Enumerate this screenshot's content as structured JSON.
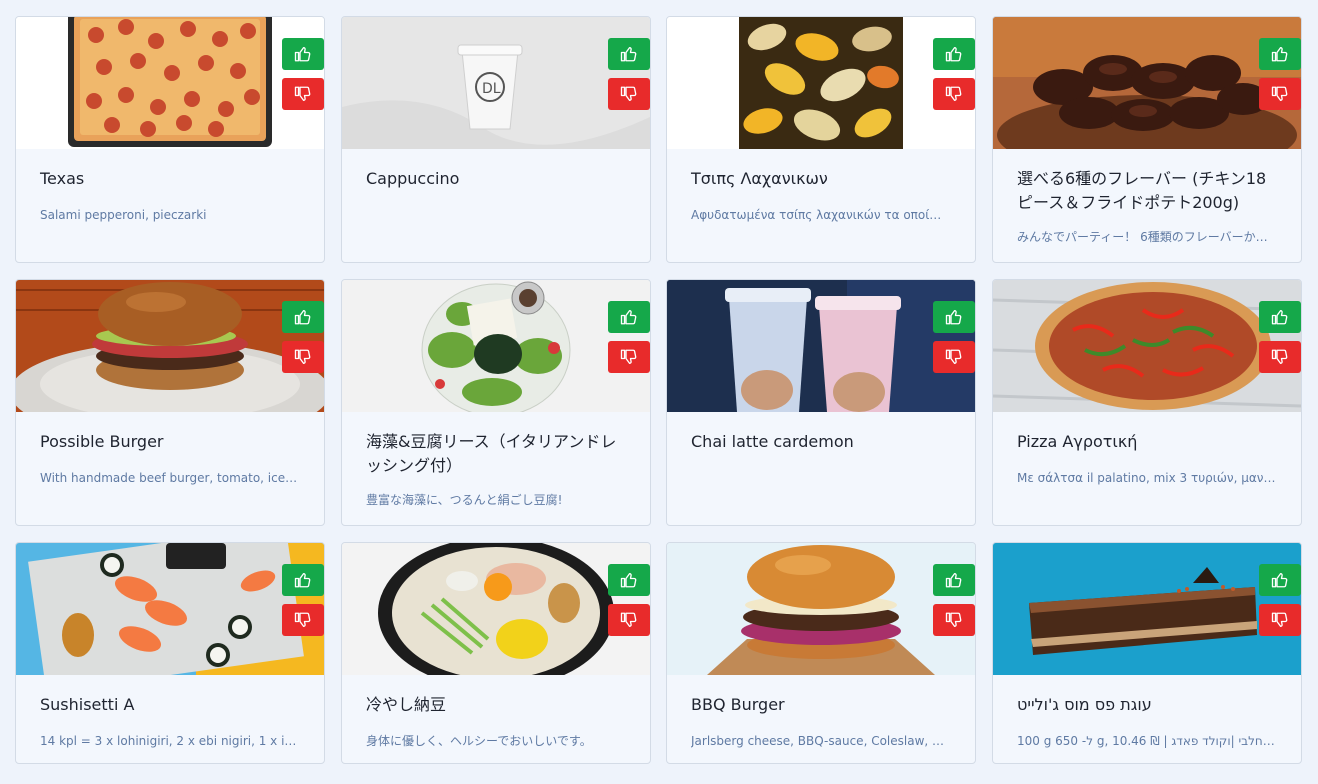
{
  "colors": {
    "like": "#15a84a",
    "dislike": "#e82b2b",
    "title": "#1f2430",
    "description": "#5f7aa3",
    "card_background": "#f3f7fd",
    "page_background": "#eef3fb"
  },
  "icons": {
    "like": "thumbs-up-icon",
    "dislike": "thumbs-down-icon"
  },
  "cards": [
    {
      "title": "Texas",
      "description": "Salami pepperoni, pieczarki",
      "image": "pepperoni-pizza"
    },
    {
      "title": "Cappuccino",
      "description": "",
      "image": "coffee-cup"
    },
    {
      "title": "Τσιπς Λαχανικων",
      "description": "Αφυδατωμένα τσίπς λαχανικών  τα οποί…",
      "image": "vegetable-chips"
    },
    {
      "title": "選べる6種のフレーバー (チキン18ピース＆フライドポテト200g)",
      "description": "みんなでパーティー！ 6種類のフレーバーか…",
      "image": "chicken-wings"
    },
    {
      "title": "Possible Burger",
      "description": "With handmade beef burger, tomato, ice…",
      "image": "burger-plate"
    },
    {
      "title": "海藻&豆腐リース（イタリアンドレッシング付）",
      "description": "豊富な海藻に、つるんと絹ごし豆腐!",
      "image": "seaweed-salad"
    },
    {
      "title": "Chai latte cardemon",
      "description": "",
      "image": "two-cups"
    },
    {
      "title": "Pizza Αγροτική",
      "description": "Με σάλτσα il palatino, mix 3 τυριών, μαν…",
      "image": "peppers-pizza"
    },
    {
      "title": "Sushisetti A",
      "description": "14 kpl = 3 x lohinigiri, 2 x ebi nigiri, 1 x i…",
      "image": "sushi-set"
    },
    {
      "title": "冷やし納豆",
      "description": "身体に優しく、ヘルシーでおいしいです。",
      "image": "natto-noodles"
    },
    {
      "title": "BBQ Burger",
      "description": "Jarlsberg cheese, BBQ-sauce, Coleslaw, …",
      "image": "bbq-burger"
    },
    {
      "title": "עוגת פס מוס ג'ולייט",
      "description": "100 g ל- 650 g, 10.46 ₪ | חלבי |וקולד פאדג'…",
      "image": "mousse-cake"
    }
  ]
}
